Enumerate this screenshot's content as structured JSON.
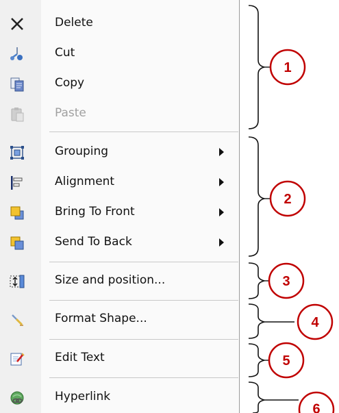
{
  "menu": {
    "items": [
      {
        "label": "Delete",
        "icon": "close-icon",
        "disabled": false,
        "submenu": false
      },
      {
        "label": "Cut",
        "icon": "scissors-icon",
        "disabled": false,
        "submenu": false
      },
      {
        "label": "Copy",
        "icon": "copy-icon",
        "disabled": false,
        "submenu": false
      },
      {
        "label": "Paste",
        "icon": "paste-icon",
        "disabled": true,
        "submenu": false
      },
      {
        "label": "Grouping",
        "icon": "grouping-icon",
        "disabled": false,
        "submenu": true
      },
      {
        "label": "Alignment",
        "icon": "alignment-icon",
        "disabled": false,
        "submenu": true
      },
      {
        "label": "Bring To Front",
        "icon": "bring-to-front-icon",
        "disabled": false,
        "submenu": true
      },
      {
        "label": "Send To Back",
        "icon": "send-to-back-icon",
        "disabled": false,
        "submenu": true
      },
      {
        "label": "Size and position...",
        "icon": "size-position-icon",
        "disabled": false,
        "submenu": false
      },
      {
        "label": "Format Shape...",
        "icon": "format-shape-icon",
        "disabled": false,
        "submenu": false
      },
      {
        "label": "Edit Text",
        "icon": "edit-text-icon",
        "disabled": false,
        "submenu": false
      },
      {
        "label": "Hyperlink",
        "icon": "hyperlink-icon",
        "disabled": false,
        "submenu": false
      }
    ]
  },
  "callouts": [
    "1",
    "2",
    "3",
    "4",
    "5",
    "6"
  ],
  "colors": {
    "callout": "#c00000"
  }
}
